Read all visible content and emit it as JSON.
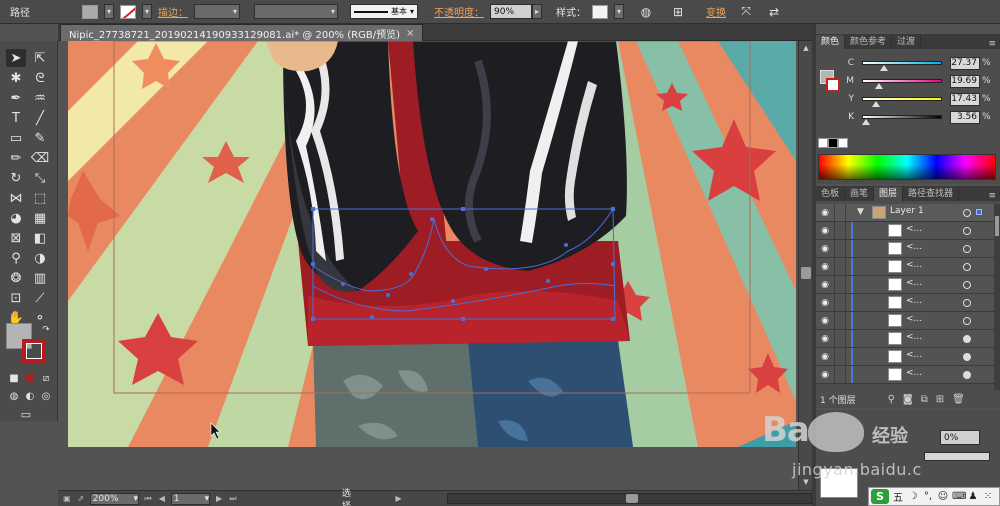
{
  "control_bar": {
    "object_type": "路径",
    "stroke_label": "描边：",
    "stroke_style_label": "基本",
    "opacity_label": "不透明度：",
    "opacity_value": "90%",
    "style_label": "样式：",
    "transform_label": "变换"
  },
  "document": {
    "tab_title": "Nipic_27738721_20190214190933129081.ai* @ 200% (RGB/预览)",
    "close_glyph": "×"
  },
  "status_bar": {
    "zoom": "200%",
    "page": "1",
    "current_tool": "选择"
  },
  "color_panel": {
    "tabs": [
      "颜色",
      "颜色参考",
      "过渡"
    ],
    "channels": [
      {
        "name": "C",
        "value": "27.37",
        "unit": "%",
        "level": 0.27,
        "gradient": "linear-gradient(to right,#fff,#00aeef)"
      },
      {
        "name": "M",
        "value": "19.69",
        "unit": "%",
        "level": 0.2,
        "gradient": "linear-gradient(to right,#fff,#ec008c)"
      },
      {
        "name": "Y",
        "value": "17.43",
        "unit": "%",
        "level": 0.17,
        "gradient": "linear-gradient(to right,#fff,#fff200)"
      },
      {
        "name": "K",
        "value": "3.56",
        "unit": "%",
        "level": 0.04,
        "gradient": "linear-gradient(to right,#fff,#000)"
      }
    ]
  },
  "layers_panel": {
    "tabs": [
      "色板",
      "画笔",
      "图层",
      "路径查找器"
    ],
    "layer_name": "Layer 1",
    "sublayer_label": "<...",
    "footer_count": "1 个图层"
  },
  "watermark": {
    "big": "Ba",
    "small": "经验",
    "url": "jingyan.baidu.c"
  },
  "ime": {
    "logo": "S",
    "mode": "五"
  }
}
